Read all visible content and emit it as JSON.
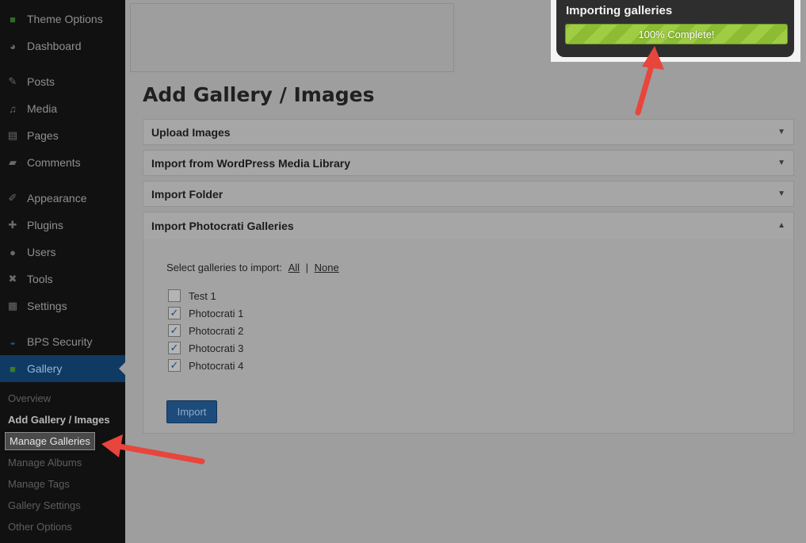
{
  "sidebar": {
    "items": [
      {
        "label": "Theme Options",
        "icon": "theme-options-icon"
      },
      {
        "label": "Dashboard",
        "icon": "dashboard-icon"
      },
      {
        "label": "Posts",
        "icon": "pin-icon"
      },
      {
        "label": "Media",
        "icon": "media-icon"
      },
      {
        "label": "Pages",
        "icon": "pages-icon"
      },
      {
        "label": "Comments",
        "icon": "comment-icon"
      },
      {
        "label": "Appearance",
        "icon": "brush-icon"
      },
      {
        "label": "Plugins",
        "icon": "plug-icon"
      },
      {
        "label": "Users",
        "icon": "user-icon"
      },
      {
        "label": "Tools",
        "icon": "wrench-icon"
      },
      {
        "label": "Settings",
        "icon": "settings-icon"
      },
      {
        "label": "BPS Security",
        "icon": "security-icon"
      },
      {
        "label": "Gallery",
        "icon": "gallery-icon",
        "active": true
      }
    ],
    "submenu": [
      {
        "label": "Overview"
      },
      {
        "label": "Add Gallery / Images",
        "current": true
      },
      {
        "label": "Manage Galleries",
        "highlighted": true
      },
      {
        "label": "Manage Albums"
      },
      {
        "label": "Manage Tags"
      },
      {
        "label": "Gallery Settings"
      },
      {
        "label": "Other Options"
      }
    ]
  },
  "main": {
    "page_title": "Add Gallery / Images",
    "sections": [
      {
        "label": "Upload Images",
        "expanded": false
      },
      {
        "label": "Import from WordPress Media Library",
        "expanded": false
      },
      {
        "label": "Import Folder",
        "expanded": false
      },
      {
        "label": "Import Photocrati Galleries",
        "expanded": true
      }
    ],
    "import_panel": {
      "select_prompt": "Select galleries to import:",
      "select_all": "All",
      "separator": "|",
      "select_none": "None",
      "galleries": [
        {
          "label": "Test 1",
          "checked": false
        },
        {
          "label": "Photocrati 1",
          "checked": true
        },
        {
          "label": "Photocrati 2",
          "checked": true
        },
        {
          "label": "Photocrati 3",
          "checked": true
        },
        {
          "label": "Photocrati 4",
          "checked": true
        }
      ],
      "import_button": "Import"
    }
  },
  "popup": {
    "title": "Importing galleries",
    "progress_text": "100% Complete!",
    "progress_percent": 100
  },
  "colors": {
    "annotation_arrow": "#e8453c",
    "progress_green": "#a0cc44",
    "active_menu": "#0e3a63"
  }
}
